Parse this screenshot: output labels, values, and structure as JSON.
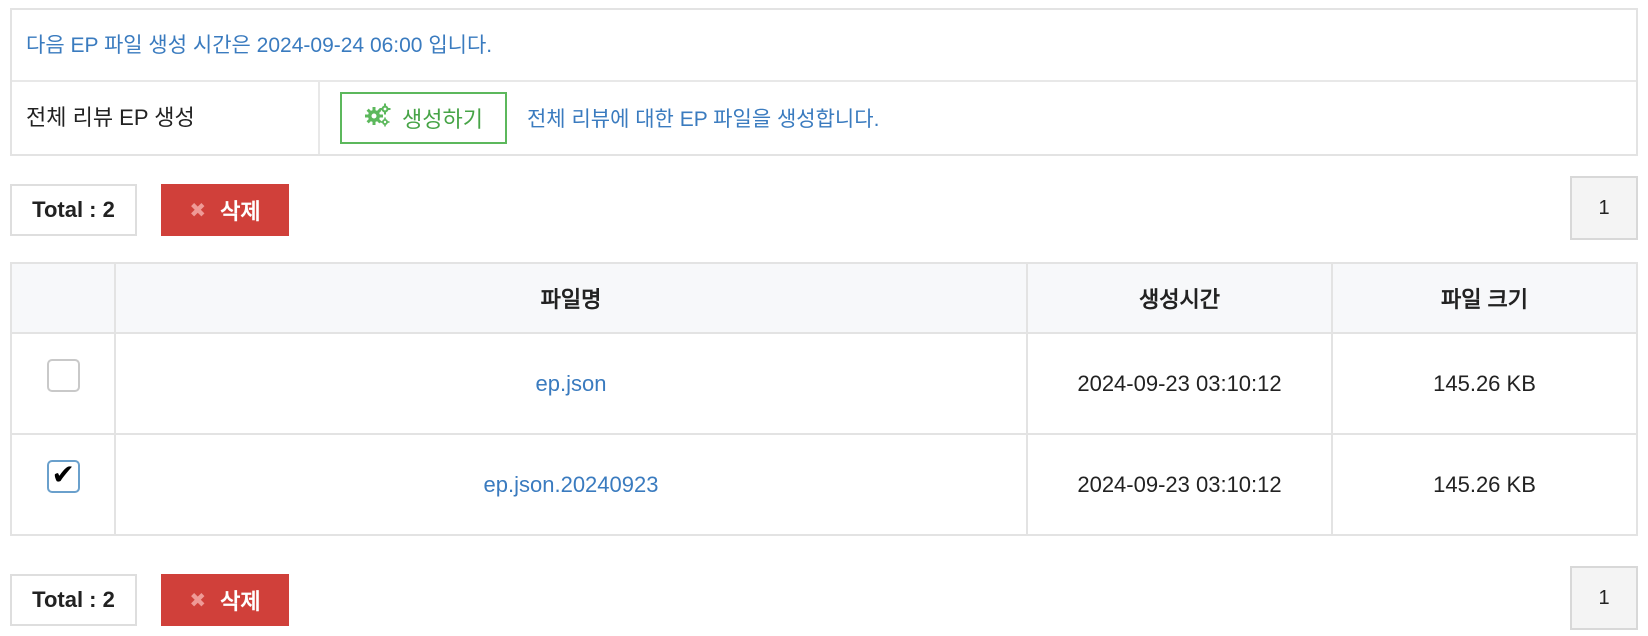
{
  "info": {
    "next_time_text": "다음 EP 파일 생성 시간은 2024-09-24 06:00 입니다.",
    "gen_label": "전체 리뷰 EP 생성",
    "gen_button_label": "생성하기",
    "gen_button_icon": "gears-icon",
    "gen_description": "전체 리뷰에 대한 EP 파일을 생성합니다."
  },
  "toolbar_top": {
    "total_label": "Total : 2",
    "delete_label": "삭제",
    "page": "1"
  },
  "toolbar_bottom": {
    "total_label": "Total : 2",
    "delete_label": "삭제",
    "page": "1"
  },
  "table": {
    "headers": [
      "",
      "파일명",
      "생성시간",
      "파일 크기"
    ],
    "rows": [
      {
        "checked": false,
        "name": "ep.json",
        "time": "2024-09-23 03:10:12",
        "size": "145.26 KB"
      },
      {
        "checked": true,
        "name": "ep.json.20240923",
        "time": "2024-09-23 03:10:12",
        "size": "145.26 KB"
      }
    ]
  },
  "colors": {
    "link_blue": "#3a7bbf",
    "generate_green": "#5cb85c",
    "delete_red": "#d0403a"
  }
}
